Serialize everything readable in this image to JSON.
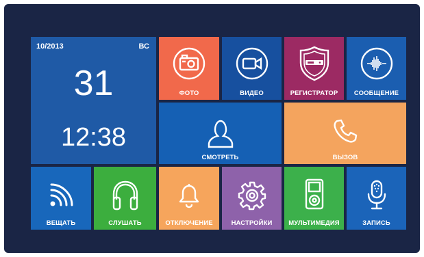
{
  "clock": {
    "date": "10/2013",
    "weekday": "ВС",
    "day": "31",
    "time": "12:38"
  },
  "tiles": {
    "photo": "ФОТО",
    "video": "ВИДЕО",
    "recorder": "РЕГИСТРАТОР",
    "message": "СООБЩЕНИЕ",
    "watch": "СМОТРЕТЬ",
    "call": "ВЫЗОВ",
    "broadcast": "ВЕЩАТЬ",
    "listen": "СЛУШАТЬ",
    "mute": "ОТКЛЮЧЕНИЕ",
    "settings": "НАСТРОЙКИ",
    "multimedia": "МУЛЬТИМЕДИЯ",
    "record": "ЗАПИСЬ"
  },
  "colors": {
    "background": "#1a2545",
    "clock": "#1f5aa6",
    "photo": "#f1694b",
    "video": "#17509f",
    "recorder": "#9c2a63",
    "message": "#1b5eb0",
    "watch": "#1560b4",
    "call": "#f4a45e",
    "broadcast": "#1867bb",
    "listen": "#3cae3e",
    "mute": "#f6a55c",
    "settings": "#8e62aa",
    "multimedia": "#3cb04b",
    "record": "#1b64b9"
  },
  "icons": {
    "photo": "camera-icon",
    "video": "video-camera-icon",
    "recorder": "shield-recorder-icon",
    "message": "voice-message-icon",
    "watch": "person-icon",
    "call": "phone-icon",
    "broadcast": "broadcast-icon",
    "listen": "headphones-icon",
    "mute": "bell-icon",
    "settings": "gear-icon",
    "multimedia": "media-player-icon",
    "record": "microphone-icon"
  }
}
